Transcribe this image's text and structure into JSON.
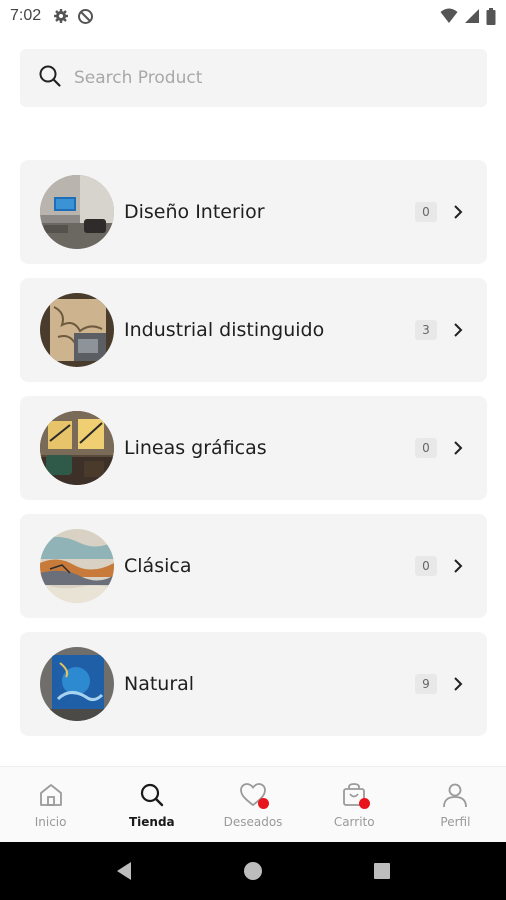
{
  "status_bar": {
    "time": "7:02",
    "icons": [
      "gear-icon",
      "sync-off-icon",
      "wifi-icon",
      "signal-icon",
      "battery-icon"
    ]
  },
  "search": {
    "placeholder": "Search Product",
    "value": ""
  },
  "categories": [
    {
      "label": "Diseño Interior",
      "count": "0",
      "image": "room-with-blue-art"
    },
    {
      "label": "Industrial distinguido",
      "count": "3",
      "image": "map-art"
    },
    {
      "label": "Lineas gráficas",
      "count": "0",
      "image": "room-with-yellow-art"
    },
    {
      "label": "Clásica",
      "count": "0",
      "image": "abstract-art"
    },
    {
      "label": "Natural",
      "count": "9",
      "image": "blue-art"
    }
  ],
  "bottom_nav": {
    "items": [
      {
        "label": "Inicio",
        "icon": "home-icon",
        "active": false,
        "badge": false
      },
      {
        "label": "Tienda",
        "icon": "search-icon",
        "active": true,
        "badge": false
      },
      {
        "label": "Deseados",
        "icon": "heart-icon",
        "active": false,
        "badge": true
      },
      {
        "label": "Carrito",
        "icon": "cart-icon",
        "active": false,
        "badge": true
      },
      {
        "label": "Perfil",
        "icon": "user-icon",
        "active": false,
        "badge": false
      }
    ]
  },
  "system_nav": [
    "back-icon",
    "home-circle-icon",
    "recents-icon"
  ],
  "colors": {
    "card_bg": "#f4f4f4",
    "badge": "#e8141d",
    "nav_active": "#1a1a1a",
    "nav_inactive": "#9a9a9a"
  }
}
